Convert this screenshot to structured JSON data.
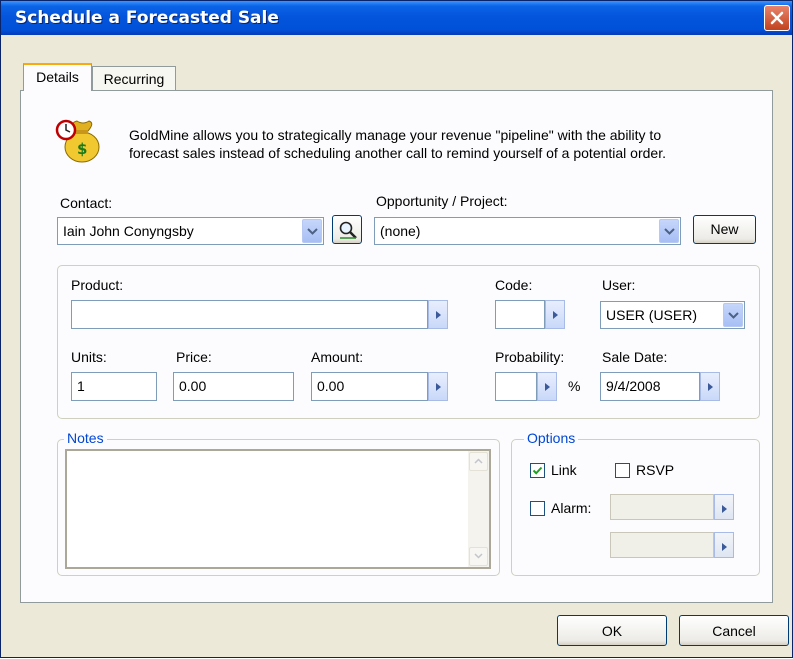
{
  "window": {
    "title": "Schedule a Forecasted Sale"
  },
  "tabs": [
    {
      "label": "Details",
      "active": true
    },
    {
      "label": "Recurring",
      "active": false
    }
  ],
  "intro": {
    "icon": "money-bag-clock-icon",
    "line1": "GoldMine allows you to strategically manage your revenue \"pipeline\" with the ability to",
    "line2": "forecast sales instead of scheduling another call to remind yourself of a potential order."
  },
  "contact": {
    "label": "Contact:",
    "value": "Iain John Conyngsby",
    "lookup_icon": "magnifier-icon"
  },
  "opportunity": {
    "label": "Opportunity / Project:",
    "value": "(none)",
    "new_label": "New"
  },
  "product": {
    "label": "Product:",
    "value": ""
  },
  "code": {
    "label": "Code:",
    "value": ""
  },
  "user": {
    "label": "User:",
    "value": "USER (USER)"
  },
  "units": {
    "label": "Units:",
    "value": "1"
  },
  "price": {
    "label": "Price:",
    "value": "0.00"
  },
  "amount": {
    "label": "Amount:",
    "value": "0.00"
  },
  "probability": {
    "label": "Probability:",
    "value": "",
    "unit": "%"
  },
  "sale_date": {
    "label": "Sale Date:",
    "value": "9/4/2008"
  },
  "notes": {
    "label": "Notes",
    "value": ""
  },
  "options": {
    "label": "Options",
    "link": {
      "label": "Link",
      "checked": true
    },
    "rsvp": {
      "label": "RSVP",
      "checked": false
    },
    "alarm": {
      "label": "Alarm:",
      "checked": false
    }
  },
  "buttons": {
    "ok": "OK",
    "cancel": "Cancel"
  },
  "colors": {
    "titlebar": "#0054e3",
    "dialog_bg": "#ece9d8",
    "group_title": "#0046d5",
    "close": "#c2421e"
  }
}
